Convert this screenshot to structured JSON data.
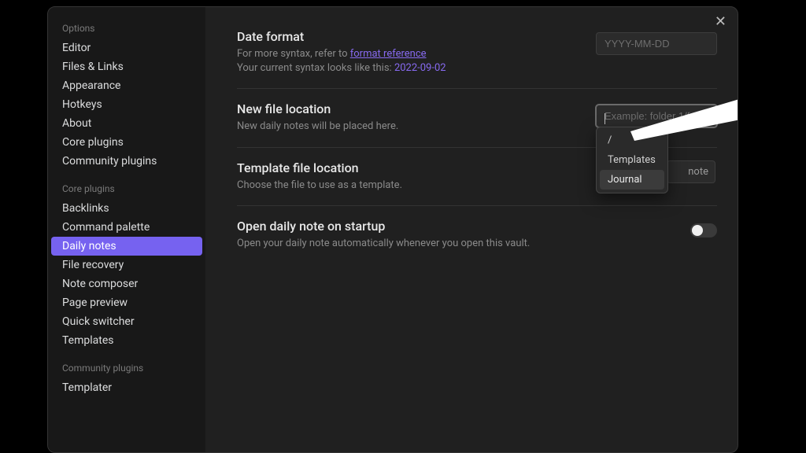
{
  "sidebar": {
    "sections": [
      {
        "title": "Options",
        "items": [
          "Editor",
          "Files & Links",
          "Appearance",
          "Hotkeys",
          "About",
          "Core plugins",
          "Community plugins"
        ]
      },
      {
        "title": "Core plugins",
        "items": [
          "Backlinks",
          "Command palette",
          "Daily notes",
          "File recovery",
          "Note composer",
          "Page preview",
          "Quick switcher",
          "Templates"
        ],
        "selected": "Daily notes"
      },
      {
        "title": "Community plugins",
        "items": [
          "Templater"
        ]
      }
    ]
  },
  "close_label": "✕",
  "settings": {
    "date_format": {
      "title": "Date format",
      "desc_prefix": "For more syntax, refer to ",
      "link_text": "format reference",
      "desc_line2_prefix": "Your current syntax looks like this: ",
      "date_preview": "2022-09-02",
      "placeholder": "YYYY-MM-DD"
    },
    "new_file_location": {
      "title": "New file location",
      "desc": "New daily notes will be placed here.",
      "placeholder": "Example: folder 1/folder 2",
      "suggestions": [
        "/",
        "Templates",
        "Journal"
      ],
      "hovered": "Journal"
    },
    "template_file_location": {
      "title": "Template file location",
      "desc": "Choose the file to use as a template.",
      "peek_text": "note"
    },
    "open_on_startup": {
      "title": "Open daily note on startup",
      "desc": "Open your daily note automatically whenever you open this vault.",
      "enabled": false
    }
  }
}
